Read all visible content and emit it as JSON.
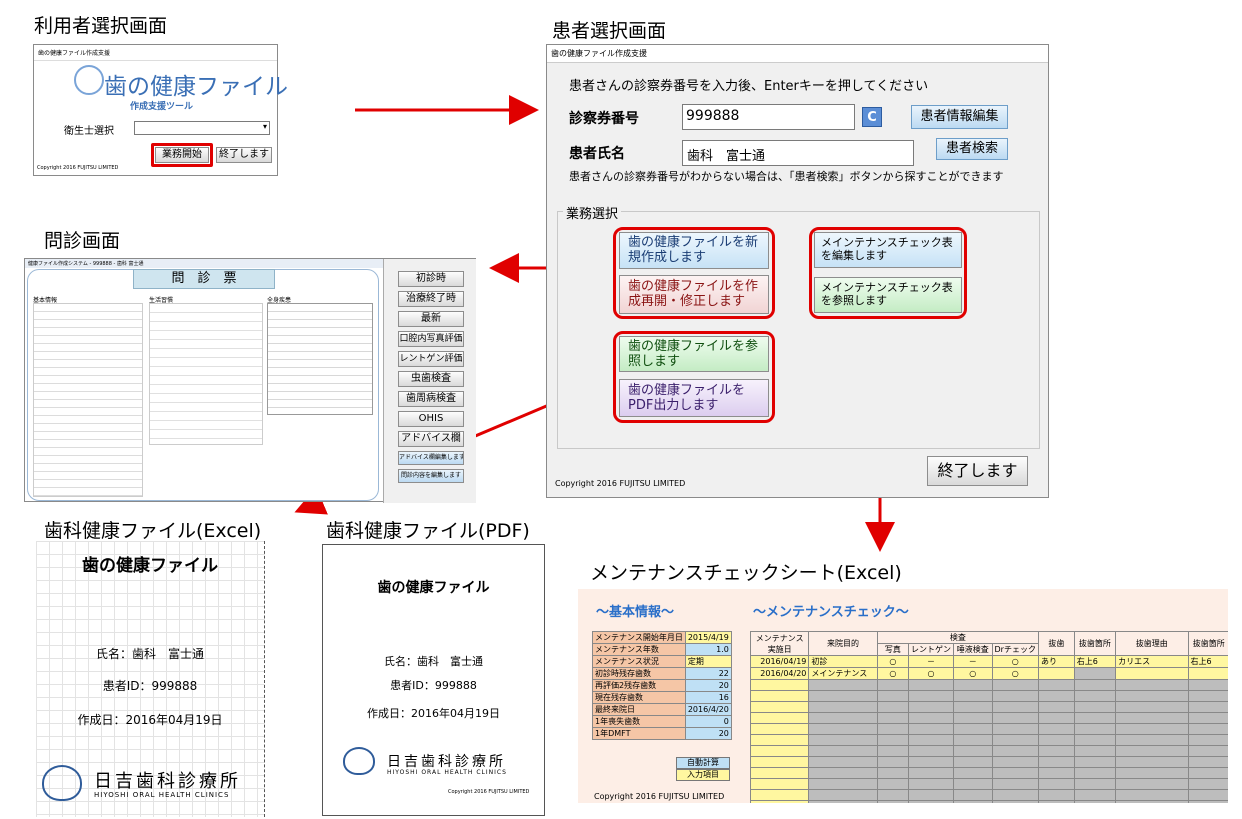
{
  "captions": {
    "user_select": "利用者選択画面",
    "patient_select": "患者選択画面",
    "interview": "問診画面",
    "excel_file": "歯科健康ファイル(Excel)",
    "pdf_file": "歯科健康ファイル(PDF)",
    "maintenance_sheet": "メンテナンスチェックシート(Excel)"
  },
  "user_window": {
    "title": "歯の健康ファイル作成支援",
    "logo": "歯の健康ファイル",
    "sub": "作成支援ツール",
    "label": "衛生士選択",
    "start": "業務開始",
    "end": "終了します",
    "copyright": "Copyright 2016 FUJITSU LIMITED"
  },
  "patient_window": {
    "title": "歯の健康ファイル作成支援",
    "instruction": "患者さんの診察券番号を入力後、Enterキーを押してください",
    "card_label": "診察券番号",
    "card_value": "999888",
    "c_btn": "C",
    "edit_btn": "患者情報編集",
    "name_label": "患者氏名",
    "name_value": "歯科　富士通",
    "search_btn": "患者検索",
    "note": "患者さんの診察券番号がわからない場合は、「患者検索」ボタンから探すことができます",
    "group": "業務選択",
    "b1": "歯の健康ファイルを新規作成します",
    "b2": "歯の健康ファイルを作成再開・修正します",
    "b3": "歯の健康ファイルを参照します",
    "b4": "歯の健康ファイルをPDF出力します",
    "m1": "メインテナンスチェック表を編集します",
    "m2": "メインテナンスチェック表を参照します",
    "end": "終了します",
    "copyright": "Copyright 2016 FUJITSU LIMITED"
  },
  "interview": {
    "title": "健康ファイル作成システム - 999888 - 歯科 富士通",
    "heading": "問　診　票",
    "sec1": "基本情報",
    "sec2": "生活習慣",
    "sec3": "全身疾患",
    "side_buttons": [
      "初診時",
      "治療終了時",
      "最新",
      "口腔内写真評価",
      "レントゲン評価",
      "虫歯検査",
      "歯周病検査",
      "OHIS",
      "アドバイス欄",
      "アドバイス欄編集します",
      "問診内容を編集します"
    ]
  },
  "excel_doc": {
    "title": "歯の健康ファイル",
    "name": "氏名：歯科　富士通",
    "pid": "患者ID：999888",
    "date": "作成日：2016年04月19日",
    "clinic": "日吉歯科診療所",
    "clinic_en": "HIYOSHI ORAL HEALTH CLINICS"
  },
  "pdf_doc": {
    "title": "歯の健康ファイル",
    "name": "氏名：歯科　富士通",
    "pid": "患者ID：999888",
    "date": "作成日：2016年04月19日",
    "clinic": "日吉歯科診療所",
    "clinic_en": "HIYOSHI ORAL HEALTH CLINICS",
    "copyright": "Copyright 2016 FUJITSU LIMITED"
  },
  "sheet": {
    "basic_title": "～基本情報～",
    "check_title": "～メンテナンスチェック～",
    "basic_rows": [
      [
        "メンテナンス開始年月日",
        "2015/4/19"
      ],
      [
        "メンテナンス年数",
        "1.0"
      ],
      [
        "メンテナンス状況",
        "定期"
      ],
      [
        "初診時残存歯数",
        "22"
      ],
      [
        "再評価2残存歯数",
        "20"
      ],
      [
        "現在残存歯数",
        "16"
      ],
      [
        "最終来院日",
        "2016/4/20"
      ],
      [
        "1年喪失歯数",
        "0"
      ],
      [
        "1年DMFT",
        "20"
      ]
    ],
    "legend_auto": "自動計算",
    "legend_input": "入力項目",
    "copyright": "Copyright 2016 FUJITSU LIMITED",
    "h_date": "メンテナンス実施日",
    "h_purpose": "来院目的",
    "h_exam": "検査",
    "h_photo": "写真",
    "h_xray": "レントゲン",
    "h_saliva": "唾液検査",
    "h_dr": "Drチェック",
    "h_ext": "抜歯",
    "h_extsite": "抜歯箇所",
    "h_reason": "抜歯理由",
    "h_extsite2": "抜歯箇所",
    "rows": [
      [
        "2016/04/19",
        "初診",
        "○",
        "－",
        "－",
        "○",
        "あり",
        "右上6",
        "カリエス",
        "右上6"
      ],
      [
        "2016/04/20",
        "メインテナンス",
        "○",
        "○",
        "○",
        "○",
        "",
        "",
        "",
        ""
      ]
    ]
  }
}
